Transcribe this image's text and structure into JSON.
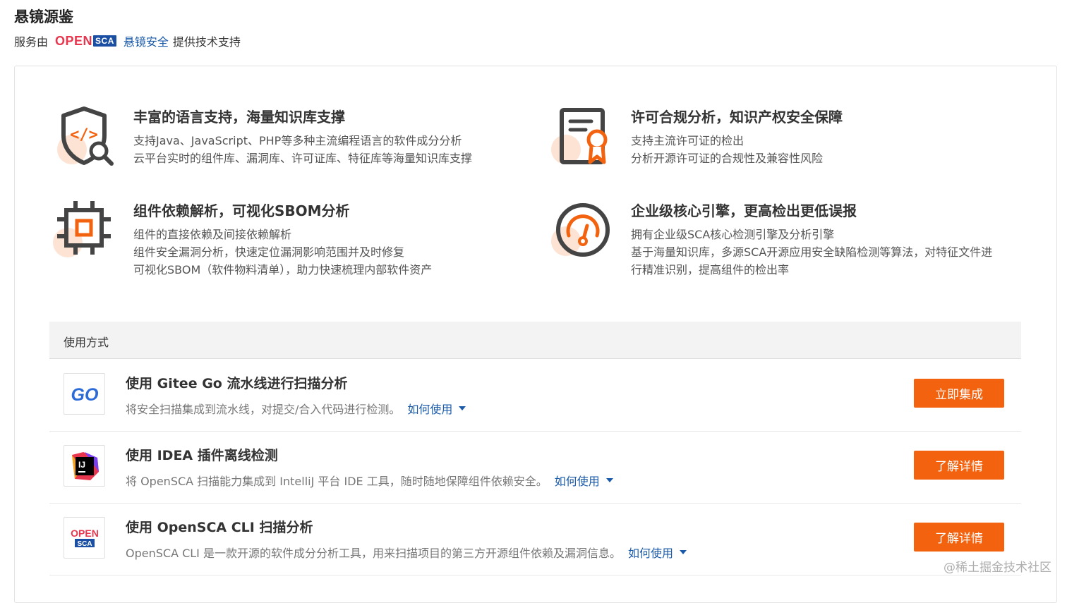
{
  "header": {
    "title": "悬镜源鉴",
    "provider_prefix": "服务由",
    "logo_open": "OPEN",
    "logo_sca": "SCA",
    "provider_link": "悬镜安全",
    "provider_suffix": "提供技术支持"
  },
  "features": [
    {
      "title": "丰富的语言支持，海量知识库支撑",
      "lines": [
        "支持Java、JavaScript、PHP等多种主流编程语言的软件成分分析",
        "云平台实时的组件库、漏洞库、许可证库、特征库等海量知识库支撑"
      ],
      "icon": "code-shield-icon"
    },
    {
      "title": "许可合规分析，知识产权安全保障",
      "lines": [
        "支持主流许可证的检出",
        "分析开源许可证的合规性及兼容性风险"
      ],
      "icon": "certificate-icon"
    },
    {
      "title": "组件依赖解析，可视化SBOM分析",
      "lines": [
        "组件的直接依赖及间接依赖解析",
        "组件安全漏洞分析，快速定位漏洞影响范围并及时修复",
        "可视化SBOM（软件物料清单），助力快速梳理内部软件资产"
      ],
      "icon": "chip-icon"
    },
    {
      "title": "企业级核心引擎，更高检出更低误报",
      "lines": [
        "拥有企业级SCA核心检测引擎及分析引擎",
        "基于海量知识库，多源SCA开源应用安全缺陷检测等算法，对特征文件进",
        "行精准识别，提高组件的检出率"
      ],
      "icon": "gauge-icon"
    }
  ],
  "usage": {
    "header": "使用方式",
    "how_to_label": "如何使用",
    "rows": [
      {
        "title": "使用 Gitee Go 流水线进行扫描分析",
        "desc": "将安全扫描集成到流水线，对提交/合入代码进行检测。",
        "button": "立即集成",
        "logo_text": "GO",
        "icon": "gitee-go-logo-icon"
      },
      {
        "title": "使用 IDEA 插件离线检测",
        "desc": "将 OpenSCA 扫描能力集成到 IntelliJ 平台 IDE 工具，随时随地保障组件依赖安全。",
        "button": "了解详情",
        "logo_text": "IJ",
        "icon": "intellij-logo-icon"
      },
      {
        "title": "使用 OpenSCA CLI 扫描分析",
        "desc": "OpenSCA CLI 是一款开源的软件成分分析工具，用来扫描项目的第三方开源组件依赖及漏洞信息。",
        "button": "了解详情",
        "logo_text_top": "OPEN",
        "logo_text_bottom": "SCA",
        "icon": "opensca-logo-icon"
      }
    ]
  },
  "watermark": "@稀土掘金技术社区",
  "colors": {
    "accent": "#f2620f",
    "link": "#1a5aa8",
    "icon_gray": "#444444",
    "icon_peach": "#fde3d3"
  }
}
